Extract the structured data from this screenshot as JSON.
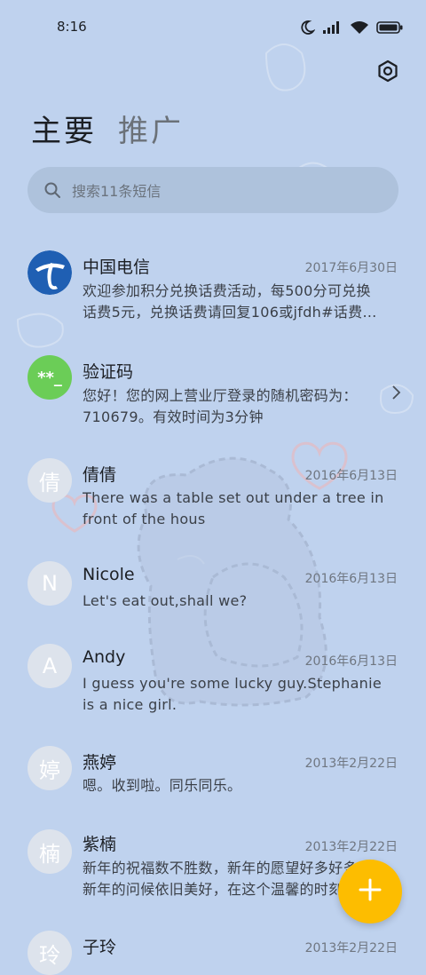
{
  "status_bar": {
    "time": "8:16",
    "icons": [
      "moon-icon",
      "signal-icon",
      "wifi-icon",
      "battery-icon"
    ]
  },
  "header": {
    "settings_icon": "settings-icon"
  },
  "tabs": [
    {
      "label": "主要",
      "active": true
    },
    {
      "label": "推广",
      "active": false
    }
  ],
  "search": {
    "placeholder": "搜索11条短信"
  },
  "messages": [
    {
      "sender": "中国电信",
      "date": "2017年6月30日",
      "avatar": "china-telecom-logo",
      "preview": [
        "欢迎参加积分兑换话费活动，每500分可兑换",
        "话费5元，兑换话费请回复106或jfdh#话费…"
      ]
    },
    {
      "sender": "验证码",
      "date": "",
      "avatar": "**_",
      "preview": [
        "您好！您的网上营业厅登录的随机密码为：",
        "710679。有效时间为3分钟"
      ],
      "has_chevron": true
    },
    {
      "sender": "倩倩",
      "date": "2016年6月13日",
      "avatar": "倩",
      "preview": [
        "There was a table set out under a tree in",
        "front of the hous"
      ]
    },
    {
      "sender": "Nicole",
      "date": "2016年6月13日",
      "avatar": "N",
      "preview": [
        "Let's eat out,shall we?"
      ]
    },
    {
      "sender": "Andy",
      "date": "2016年6月13日",
      "avatar": "A",
      "preview": [
        "I guess you're some lucky guy.Stephanie",
        "is a nice girl."
      ]
    },
    {
      "sender": "燕婷",
      "date": "2013年2月22日",
      "avatar": "婷",
      "preview": [
        "嗯。收到啦。同乐同乐。"
      ]
    },
    {
      "sender": "紫楠",
      "date": "2013年2月22日",
      "avatar": "楠",
      "preview": [
        "新年的祝福数不胜数，新年的愿望好多好多",
        "新年的问候依旧美好，在这个温馨的时刻"
      ]
    },
    {
      "sender": "子玲",
      "date": "2013年2月22日",
      "avatar": "玲",
      "preview": []
    }
  ],
  "fab": {
    "icon": "plus-icon"
  },
  "colors": {
    "background": "#bfd2ee",
    "fab": "#fdbd00",
    "green_avatar": "#6bcd57",
    "telecom_blue": "#1f5fb3"
  }
}
